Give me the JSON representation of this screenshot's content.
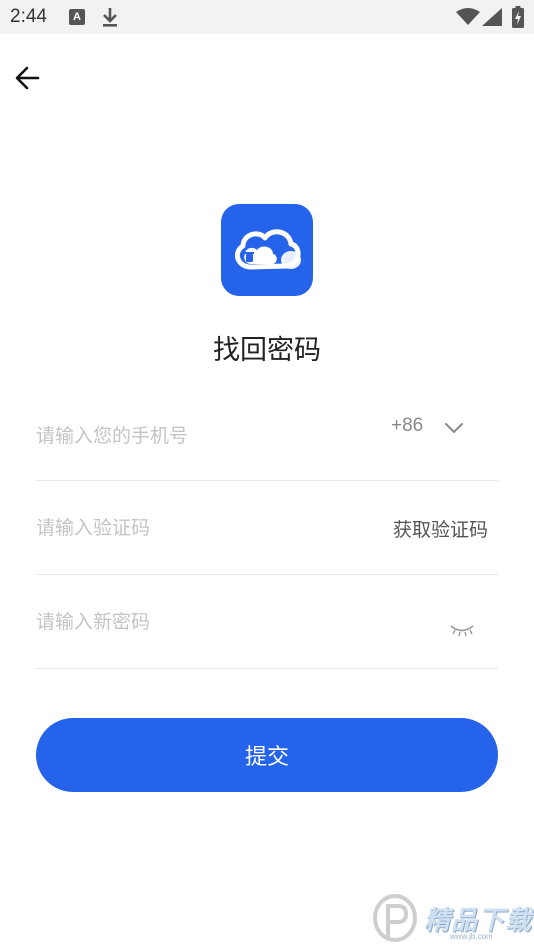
{
  "status_bar": {
    "time": "2:44",
    "notification_letter": "A",
    "icons": [
      "download-icon",
      "wifi-icon",
      "signal-icon",
      "battery-icon"
    ]
  },
  "header": {
    "back_icon": "arrow-left-icon"
  },
  "app": {
    "logo_icon": "cloud-trash-icon",
    "brand_color": "#2563eb"
  },
  "page": {
    "title": "找回密码"
  },
  "form": {
    "phone": {
      "placeholder": "请输入您的手机号",
      "value": "",
      "country_code": "+86"
    },
    "code": {
      "placeholder": "请输入验证码",
      "value": "",
      "get_code_label": "获取验证码"
    },
    "password": {
      "placeholder": "请输入新密码",
      "value": "",
      "eye_icon": "eye-closed-icon"
    },
    "submit_label": "提交"
  },
  "watermark": {
    "text": "精品下载",
    "sub": "www.jb.com"
  }
}
